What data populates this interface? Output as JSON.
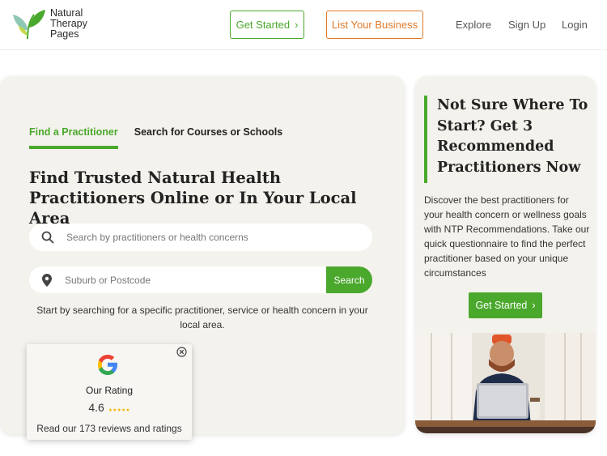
{
  "header": {
    "logo_lines": [
      "Natural",
      "Therapy",
      "Pages"
    ],
    "get_started": "Get Started",
    "get_started_chevron": "›",
    "list_business": "List Your Business",
    "nav": {
      "explore": "Explore",
      "signup": "Sign Up",
      "login": "Login"
    }
  },
  "search": {
    "tabs": [
      {
        "label": "Find a Practitioner",
        "active": true
      },
      {
        "label": "Search for Courses or Schools",
        "active": false
      }
    ],
    "headline": "Find Trusted Natural Health Practitioners Online or In Your Local Area",
    "query_placeholder": "Search by practitioners or health concerns",
    "location_placeholder": "Suburb or Postcode",
    "button": "Search",
    "helper": "Start by searching for a specific practitioner, service or health concern in your local area."
  },
  "rating": {
    "title": "Our Rating",
    "score": "4.6",
    "stars": "★★★★★",
    "reviews": "Read our 173 reviews and ratings"
  },
  "recommend": {
    "title": "Not Sure Where To Start? Get 3 Recommended Practitioners Now",
    "description": "Discover the best practitioners for your health concern or wellness goals with NTP Recommendations. Take our quick questionnaire to find the perfect practitioner based on your unique circumstances",
    "button": "Get Started",
    "button_chevron": "›"
  },
  "colors": {
    "green": "#4aa82c",
    "orange": "#e07a2a",
    "card": "#f4f2ec"
  },
  "icons": [
    "logo-leaf-icon",
    "search-icon",
    "location-pin-icon",
    "close-icon",
    "google-g-icon"
  ]
}
